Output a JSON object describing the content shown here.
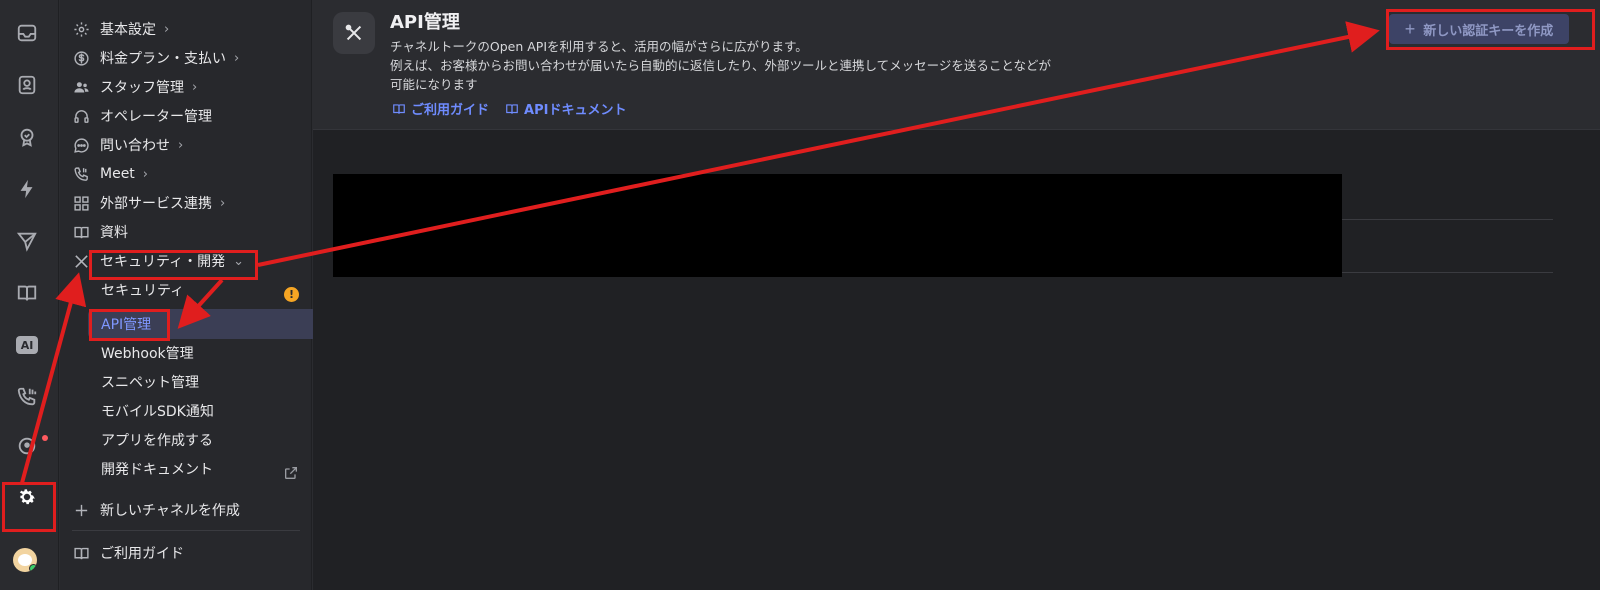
{
  "rail": {
    "icons": [
      "inbox-icon",
      "contacts-icon",
      "badge-icon",
      "bolt-icon",
      "send-icon",
      "book-icon",
      "ai-icon",
      "phone-icon",
      "chat-bubble-icon",
      "gear-icon"
    ],
    "ai_label": "AI"
  },
  "nav": {
    "items": [
      {
        "label": "基本設定",
        "icon": "gear-icon",
        "has_chevron": true
      },
      {
        "label": "料金プラン・支払い",
        "icon": "dollar-icon",
        "has_chevron": true
      },
      {
        "label": "スタッフ管理",
        "icon": "people-icon",
        "has_chevron": true
      },
      {
        "label": "オペレーター管理",
        "icon": "headset-icon",
        "has_chevron": false
      },
      {
        "label": "問い合わせ",
        "icon": "chat-icon",
        "has_chevron": true
      },
      {
        "label": "Meet",
        "icon": "phone-icon",
        "has_chevron": true
      },
      {
        "label": "外部サービス連携",
        "icon": "grid-icon",
        "has_chevron": true
      },
      {
        "label": "資料",
        "icon": "book-icon",
        "has_chevron": false
      },
      {
        "label": "セキュリティ・開発",
        "icon": "tools-icon",
        "has_chevron": true
      }
    ],
    "sub_items": [
      "セキュリティ",
      "API管理",
      "Webhook管理",
      "スニペット管理",
      "モバイルSDK通知",
      "アプリを作成する",
      "開発ドキュメント"
    ],
    "selected_sub": "API管理",
    "warning_badge": "!",
    "create_channel": "新しいチャネルを作成",
    "guide": "ご利用ガイド"
  },
  "header": {
    "title": "API管理",
    "description_1": "チャネルトークのOpen APIを利用すると、活用の幅がさらに広がります。",
    "description_2": "例えば、お客様からお問い合わせが届いたら自動的に返信したり、外部ツールと連携してメッセージを送ることなどが",
    "description_3": "可能になります",
    "link_guide": "ご利用ガイド",
    "link_docs": "APIドキュメント",
    "create_button": "新しい認証キーを作成",
    "create_button_icon": "+"
  },
  "colors": {
    "accent": "#6f8cff",
    "annotation_red": "#e01e1e",
    "selected_bg": "#3b3e55",
    "warning": "#f5a524"
  }
}
